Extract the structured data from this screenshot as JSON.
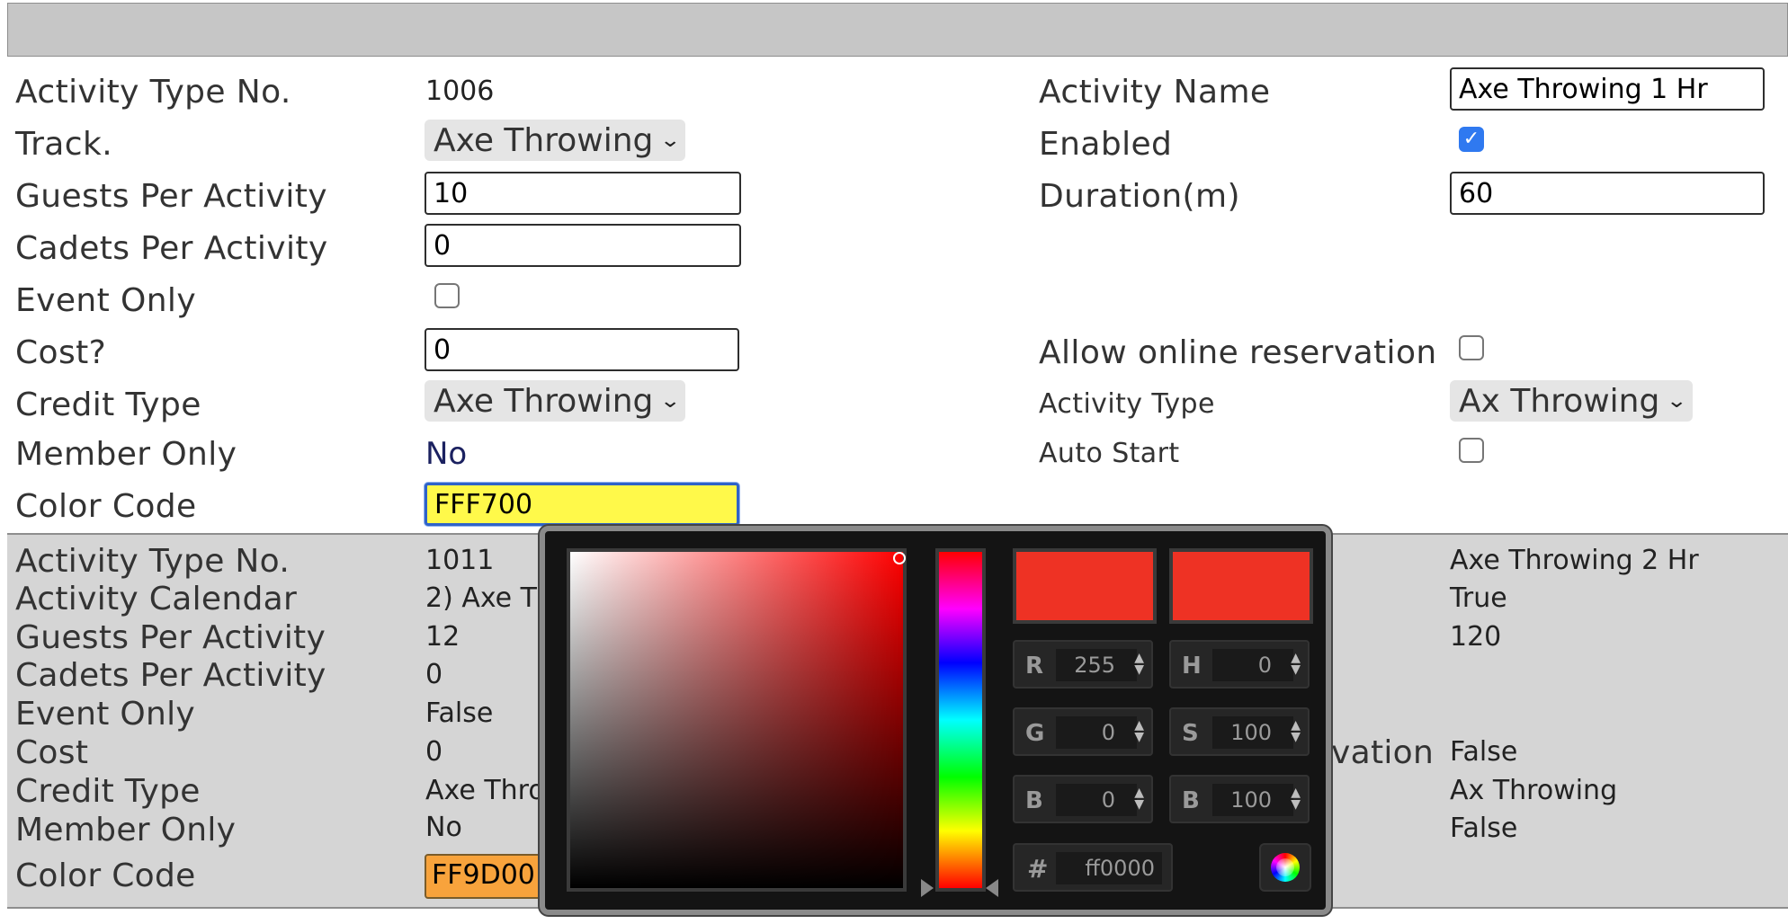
{
  "form": {
    "activity_type_no_label": "Activity Type No.",
    "activity_type_no_value": "1006",
    "activity_name_label": "Activity Name",
    "activity_name_value": "Axe Throwing 1 Hr",
    "track_label": "Track.",
    "track_value": "Axe Throwing",
    "enabled_label": "Enabled",
    "enabled_checked": true,
    "guests_label": "Guests Per Activity",
    "guests_value": "10",
    "duration_label": "Duration(m)",
    "duration_value": "60",
    "cadets_label": "Cadets Per Activity",
    "cadets_value": "0",
    "event_only_label": "Event Only",
    "cost_label": "Cost?",
    "cost_value": "0",
    "allow_online_label": "Allow online reservation",
    "credit_type_label": "Credit Type",
    "credit_type_value": "Axe Throwing",
    "activity_type_label": "Activity Type",
    "activity_type_value": "Ax Throwing",
    "member_only_label": "Member Only",
    "member_only_value": "No",
    "auto_start_label": "Auto Start",
    "color_code_label": "Color Code",
    "color_code_value": "FFF700",
    "color_code_bg": "#fff94a"
  },
  "record2": {
    "activity_type_no_label": "Activity Type No.",
    "activity_type_no_value": "1011",
    "activity_calendar_label": "Activity Calendar",
    "activity_calendar_value": "2) Axe T",
    "guests_label": "Guests Per Activity",
    "guests_value": "12",
    "cadets_label": "Cadets Per Activity",
    "cadets_value": "0",
    "event_only_label": "Event Only",
    "event_only_value": "False",
    "cost_label": "Cost",
    "cost_value": "0",
    "credit_type_label": "Credit Type",
    "credit_type_value": "Axe Thro",
    "member_only_label": "Member Only",
    "member_only_value": "No",
    "color_code_label": "Color Code",
    "color_code_value": "FF9D00",
    "right_name_value": "Axe Throwing 2 Hr",
    "right_enabled_value": "True",
    "right_duration_value": "120",
    "right_reservation_partial": "vation",
    "right_reservation_value": "False",
    "right_activity_type_value": "Ax Throwing",
    "right_auto_start_value": "False"
  },
  "picker": {
    "r_label": "R",
    "r_value": "255",
    "g_label": "G",
    "g_value": "0",
    "b_label": "B",
    "b_value": "0",
    "h_label": "H",
    "h_value": "0",
    "s_label": "S",
    "s_value": "100",
    "bv_label": "B",
    "bv_value": "100",
    "hex_label": "#",
    "hex_value": "ff0000",
    "current_color": "#ee3224",
    "new_color": "#ee3224"
  }
}
